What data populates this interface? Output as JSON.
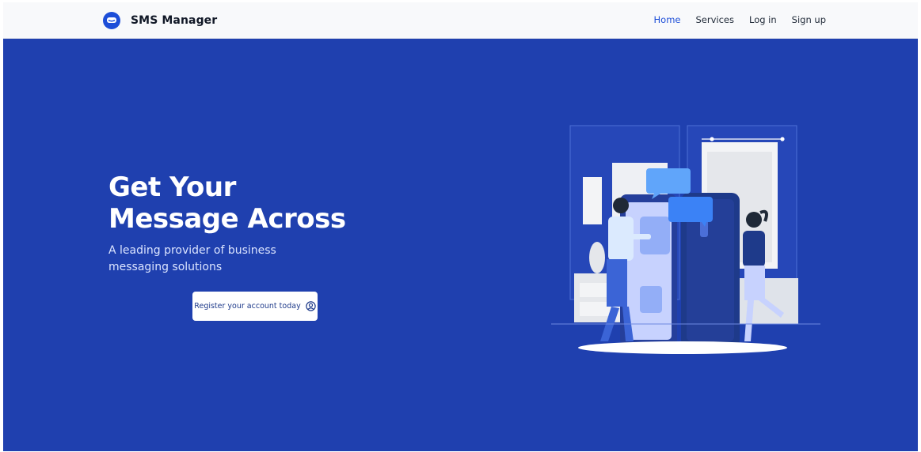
{
  "navbar": {
    "brand_name": "SMS Manager",
    "brand_icon": "chat-bubble-icon",
    "links": [
      {
        "label": "Home",
        "active": true
      },
      {
        "label": "Services",
        "active": false
      },
      {
        "label": "Log in",
        "active": false
      },
      {
        "label": "Sign up",
        "active": false
      }
    ]
  },
  "hero": {
    "title_line_1": "Get Your",
    "title_line_2": "Message Across",
    "subtitle": "A leading provider of business messaging solutions",
    "cta_label": "Register your account today",
    "cta_icon": "user-circle-icon",
    "background_color": "#1f40af",
    "accent_color": "#1d4ed8"
  }
}
